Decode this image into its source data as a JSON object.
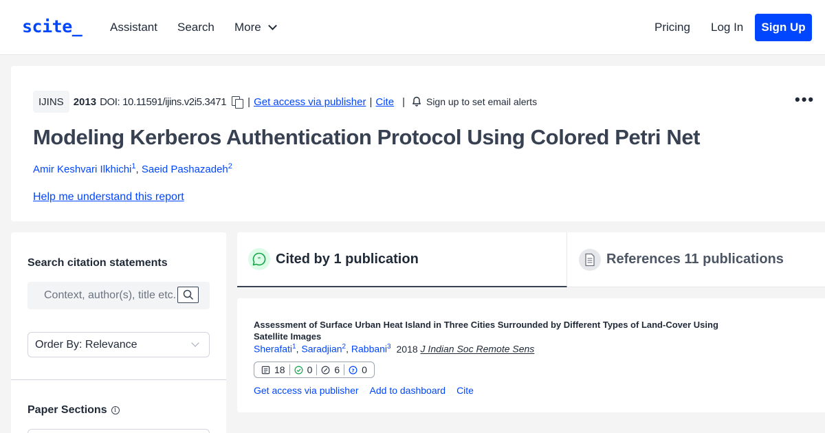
{
  "header": {
    "logo": "scite_",
    "nav": {
      "assistant": "Assistant",
      "search": "Search",
      "more": "More"
    },
    "pricing": "Pricing",
    "login": "Log In",
    "signup": "Sign Up"
  },
  "paper": {
    "journal": "IJINS",
    "year": "2013",
    "doi": "DOI: 10.11591/ijins.v2i5.3471",
    "separator": "|",
    "access_link": "Get access via publisher",
    "cite_link": "Cite",
    "alert_text": "Sign up to set email alerts",
    "more_menu": "•••",
    "title": "Modeling Kerberos Authentication Protocol Using Colored Petri Net",
    "authors": [
      {
        "name": "Amir Keshvari Ilkhichi",
        "sup": "1"
      },
      {
        "name": "Saeid Pashazadeh",
        "sup": "2"
      }
    ],
    "author_separator": ",",
    "help_link": "Help me understand this report"
  },
  "sidebar": {
    "search_heading": "Search citation statements",
    "search_placeholder": "Context, author(s), title etc.",
    "order_by": "Order By: Relevance",
    "sections_heading": "Paper Sections",
    "info_symbol": "i"
  },
  "tabs": {
    "cited_by": "Cited by 1 publication",
    "references": "References 11 publications"
  },
  "citation": {
    "title": "Assessment of Surface Urban Heat Island in Three Cities Surrounded by Different Types of Land-Cover Using Satellite Images",
    "authors": [
      {
        "name": "Sherafati",
        "sup": "1"
      },
      {
        "name": "Saradjian",
        "sup": "2"
      },
      {
        "name": "Rabbani",
        "sup": "3"
      }
    ],
    "author_separator": ",",
    "year": "2018",
    "journal": "J Indian Soc Remote Sens",
    "tallies": {
      "publications": "18",
      "supporting": "0",
      "mentioning": "6",
      "contrasting": "0"
    },
    "actions": {
      "access": "Get access via publisher",
      "dashboard": "Add to dashboard",
      "cite": "Cite"
    }
  },
  "colors": {
    "brand": "#0046ff",
    "supporting": "#16a34a",
    "contrasting": "#0046ff"
  }
}
